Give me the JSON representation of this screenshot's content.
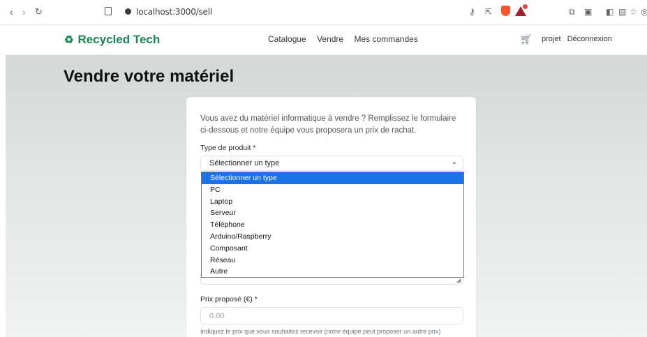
{
  "browser": {
    "url": "localhost:3000/sell",
    "nav": {
      "back": "‹",
      "forward": "›",
      "reload": "↻"
    }
  },
  "site": {
    "brand": "Recycled Tech",
    "brand_icon": "recycle-icon",
    "nav": [
      "Catalogue",
      "Vendre",
      "Mes commandes"
    ],
    "user": "projet",
    "logout": "Déconnexion"
  },
  "page": {
    "title": "Vendre votre matériel",
    "intro": "Vous avez du matériel informatique à vendre ? Remplissez le formulaire ci-dessous et notre équipe vous proposera un prix de rachat.",
    "type_label": "Type de produit *",
    "type_value": "Sélectionner un type",
    "price_label": "Prix proposé (€) *",
    "price_placeholder": "0.00",
    "price_help": "Indiquez le prix que vous souhaitez recevoir (notre équipe peut proposer un autre prix)"
  },
  "dropdown": {
    "options": [
      "Sélectionner un type",
      "PC",
      "Laptop",
      "Serveur",
      "Téléphone",
      "Arduino/Raspberry",
      "Composant",
      "Réseau",
      "Autre"
    ],
    "selected_index": 0
  },
  "colors": {
    "brand": "#198754",
    "selected": "#1a73e8"
  }
}
